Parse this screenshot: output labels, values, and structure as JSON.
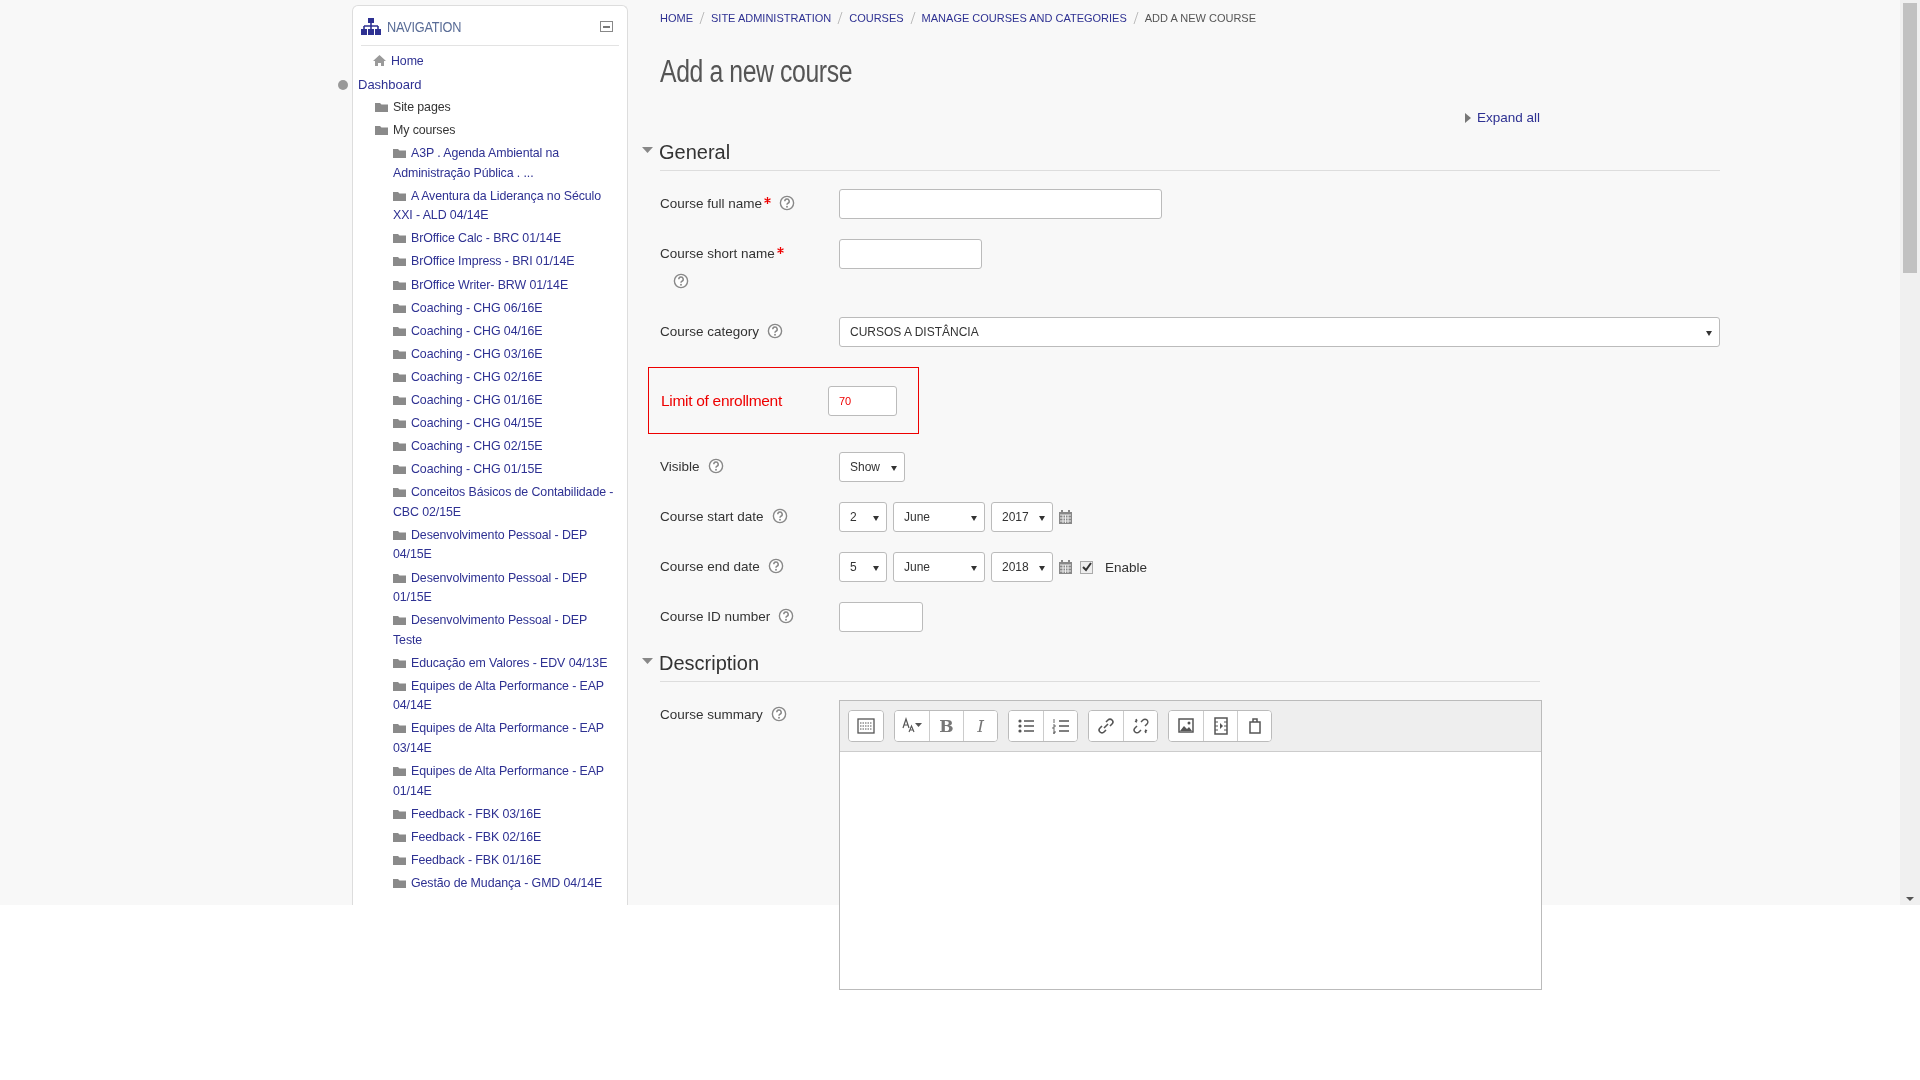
{
  "navigation": {
    "title": "NAVIGATION",
    "items": [
      {
        "label": "Home",
        "kind": "home"
      },
      {
        "label": "Dashboard",
        "kind": "node",
        "children": [
          {
            "label": "Site pages",
            "kind": "folder"
          },
          {
            "label": "My courses",
            "kind": "folder",
            "children": [
              {
                "label": "A3P . Agenda Ambiental na Administração Pública . ...",
                "kind": "folder"
              },
              {
                "label": "A Aventura da Liderança no Século XXI - ALD 04/14E",
                "kind": "folder"
              },
              {
                "label": "BrOffice Calc - BRC 01/14E",
                "kind": "folder"
              },
              {
                "label": "BrOffice Impress - BRI 01/14E",
                "kind": "folder"
              },
              {
                "label": "BrOffice Writer- BRW 01/14E",
                "kind": "folder"
              },
              {
                "label": "Coaching - CHG 06/16E",
                "kind": "folder"
              },
              {
                "label": "Coaching - CHG 04/16E",
                "kind": "folder"
              },
              {
                "label": "Coaching - CHG 03/16E",
                "kind": "folder"
              },
              {
                "label": "Coaching - CHG 02/16E",
                "kind": "folder"
              },
              {
                "label": "Coaching - CHG 01/16E",
                "kind": "folder"
              },
              {
                "label": "Coaching - CHG 04/15E",
                "kind": "folder"
              },
              {
                "label": "Coaching - CHG 02/15E",
                "kind": "folder"
              },
              {
                "label": "Coaching - CHG 01/15E",
                "kind": "folder"
              },
              {
                "label": "Conceitos Básicos de Contabilidade - CBC 02/15E",
                "kind": "folder"
              },
              {
                "label": "Desenvolvimento Pessoal - DEP 04/15E",
                "kind": "folder"
              },
              {
                "label": "Desenvolvimento Pessoal - DEP 01/15E",
                "kind": "folder"
              },
              {
                "label": "Desenvolvimento Pessoal - DEP Teste",
                "kind": "folder"
              },
              {
                "label": "Educação em Valores - EDV 04/13E",
                "kind": "folder"
              },
              {
                "label": "Equipes de Alta Performance - EAP 04/14E",
                "kind": "folder"
              },
              {
                "label": "Equipes de Alta Performance - EAP 03/14E",
                "kind": "folder"
              },
              {
                "label": "Equipes de Alta Performance - EAP 01/14E",
                "kind": "folder"
              },
              {
                "label": "Feedback - FBK 03/16E",
                "kind": "folder"
              },
              {
                "label": "Feedback - FBK 02/16E",
                "kind": "folder"
              },
              {
                "label": "Feedback - FBK 01/16E",
                "kind": "folder"
              },
              {
                "label": "Gestão de Mudança - GMD 04/14E",
                "kind": "folder"
              }
            ]
          }
        ]
      }
    ]
  },
  "breadcrumbs": [
    {
      "label": "HOME",
      "current": false
    },
    {
      "label": "SITE ADMINISTRATION",
      "current": false
    },
    {
      "label": "COURSES",
      "current": false
    },
    {
      "label": "MANAGE COURSES AND CATEGORIES",
      "current": false
    },
    {
      "label": "ADD A NEW COURSE",
      "current": true
    }
  ],
  "page_title": "Add a new course",
  "expand_all": "Expand all",
  "sections": [
    {
      "title": "General",
      "expanded": true,
      "fields": [
        {
          "kind": "text",
          "label": "Course full name",
          "required": true,
          "help": true
        },
        {
          "kind": "text",
          "label": "Course short name",
          "required": true,
          "help": true
        },
        {
          "kind": "select",
          "label": "Course category",
          "help": true,
          "value": "CURSOS A DISTÂNCIA"
        },
        {
          "kind": "highlight",
          "label": "Limit of enrollment",
          "value": "70"
        },
        {
          "kind": "select",
          "label": "Visible",
          "help": true,
          "value": "Show"
        },
        {
          "kind": "date",
          "label": "Course start date",
          "help": true,
          "day": "2",
          "month": "June",
          "year": "2017"
        },
        {
          "kind": "date",
          "label": "Course end date",
          "help": true,
          "day": "5",
          "month": "June",
          "year": "2018",
          "enable": {
            "label": "Enable",
            "checked": true
          }
        },
        {
          "kind": "text",
          "label": "Course ID number",
          "help": true
        }
      ]
    },
    {
      "title": "Description",
      "expanded": true,
      "fields": [
        {
          "kind": "editor",
          "label": "Course summary",
          "help": true,
          "toolbar": [
            [
              {
                "kind": "toggle"
              }
            ],
            [
              {
                "kind": "font"
              },
              {
                "kind": "bold",
                "label": "B"
              },
              {
                "kind": "italic",
                "label": "I"
              }
            ],
            [
              {
                "kind": "bullets"
              },
              {
                "kind": "numbers"
              }
            ],
            [
              {
                "kind": "link"
              },
              {
                "kind": "unlink"
              }
            ],
            [
              {
                "kind": "image"
              },
              {
                "kind": "media"
              },
              {
                "kind": "files"
              }
            ]
          ]
        }
      ]
    }
  ]
}
